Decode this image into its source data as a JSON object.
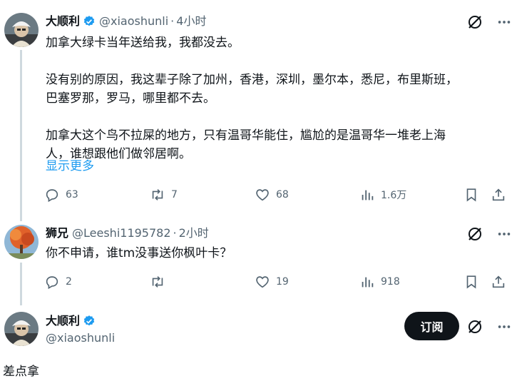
{
  "tweet1": {
    "author_name": "大顺利",
    "handle": "@xiaoshunli",
    "separator": "·",
    "time": "4小时",
    "paragraphs": [
      [
        "加拿大绿卡当年送给我，我都没去。"
      ],
      [
        "没有别的原因，我这辈子除了加州，香港，深圳，墨尔本，悉尼，布里斯班，",
        "巴塞罗那，罗马，哪里都不去。"
      ],
      [
        "加拿大这个鸟不拉屎的地方，只有温哥华能住，尴尬的是温哥华一堆老上海",
        "人，谁想跟他们做邻居啊。"
      ]
    ],
    "show_more": "显示更多",
    "replies": "63",
    "reposts": "7",
    "likes": "68",
    "views": "1.6万"
  },
  "tweet2": {
    "author_name": "狮兄",
    "handle": "@Leeshi1195782",
    "separator": "·",
    "time": "2小时",
    "text": "你不申请，谁tm没事送你枫叶卡？",
    "replies": "2",
    "reposts": "",
    "likes": "19",
    "views": "918"
  },
  "profile": {
    "author_name": "大顺利",
    "handle": "@xiaoshunli",
    "subscribe_label": "订阅",
    "reply_text": "差点拿"
  },
  "icons": {
    "verified": "verified-badge-icon",
    "grok": "grok-icon",
    "more": "more-icon",
    "reply": "reply-icon",
    "repost": "repost-icon",
    "like": "like-icon",
    "views": "views-icon",
    "bookmark": "bookmark-icon",
    "share": "share-icon"
  },
  "colors": {
    "text": "#0f1419",
    "secondary": "#536471",
    "link": "#1d9bf0",
    "verified": "#1d9bf0",
    "thread_line": "#cfd9de",
    "subscribe_bg": "#0f1419"
  }
}
